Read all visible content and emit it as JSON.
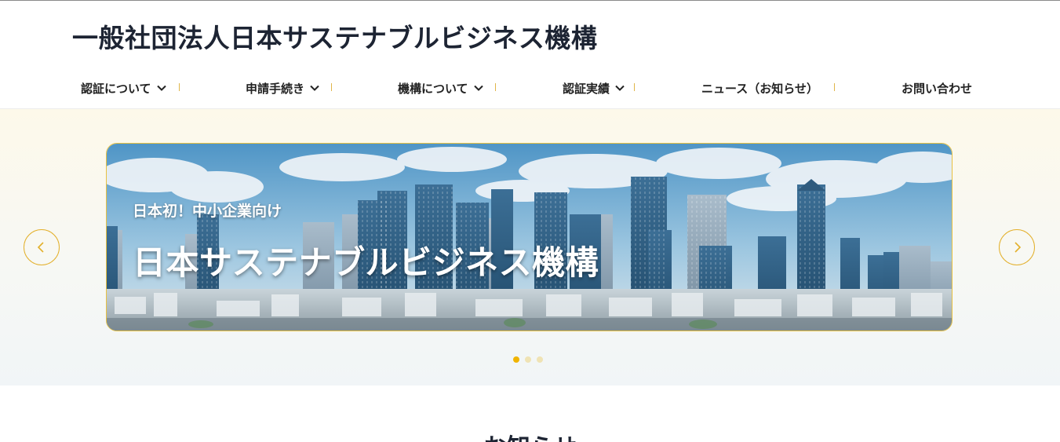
{
  "header": {
    "site_title": "一般社団法人日本サステナブルビジネス機構"
  },
  "nav": {
    "items": [
      {
        "label": "認証について",
        "has_dropdown": true
      },
      {
        "label": "申請手続き",
        "has_dropdown": true
      },
      {
        "label": "機構について",
        "has_dropdown": true
      },
      {
        "label": "認証実績",
        "has_dropdown": true
      },
      {
        "label": "ニュース（お知らせ）",
        "has_dropdown": false
      },
      {
        "label": "お問い合わせ",
        "has_dropdown": false
      }
    ]
  },
  "hero": {
    "slide": {
      "subtitle": "日本初！中小企業向け",
      "title": "日本サステナブルビジネス機構",
      "image": "city-skyline"
    },
    "slide_count": 3,
    "active_slide": 1
  },
  "section": {
    "heading": "お知らせ"
  },
  "colors": {
    "accent": "#f0b400",
    "title_text": "#1d2433",
    "hero_bg": "#fdf9ea"
  },
  "icons": [
    "chevron-down-icon",
    "chevron-left-icon",
    "chevron-right-icon"
  ]
}
